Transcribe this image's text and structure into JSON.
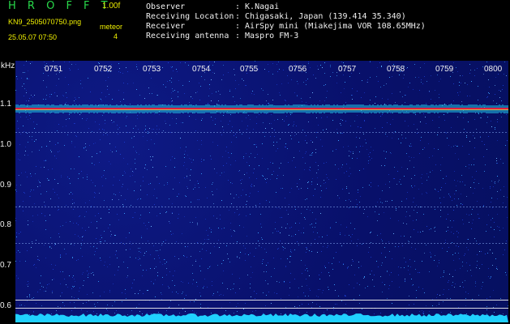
{
  "header": {
    "app_title": "H R O F F T",
    "version": "1.00f",
    "filename": "KN9_2505070750.png",
    "mode": "meteor",
    "datetime": "25.05.07 07:50",
    "number": "4",
    "observer_label": "Observer",
    "observer_value": ": K.Nagai",
    "location_label": "Receiving Location",
    "location_value": ": Chigasaki, Japan (139.414 35.340)",
    "receiver_label": "Receiver",
    "receiver_value": ": AirSpy mini (Miakejima VOR 108.65MHz)",
    "antenna_label": "Receiving antenna",
    "antenna_value": ": Maspro FM-3"
  },
  "spectrogram": {
    "unit_label": "kHz",
    "y_ticks": [
      "1.1",
      "1.0",
      "0.9",
      "0.8",
      "0.7",
      "0.6"
    ],
    "x_ticks": [
      "0751",
      "0752",
      "0753",
      "0754",
      "0755",
      "0756",
      "0757",
      "0758",
      "0759",
      "0800"
    ],
    "colors": {
      "background": "#08106a",
      "carrier": "#e02040",
      "noise_bright": "#3aa0ff",
      "baseline": "#20d0ff",
      "guide_line": "#f0f0f0"
    }
  }
}
